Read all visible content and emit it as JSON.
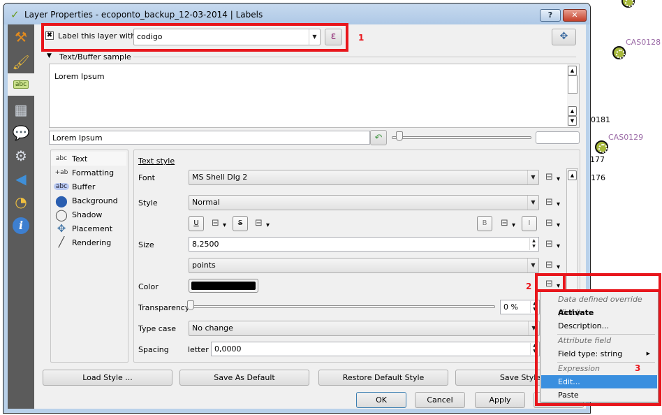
{
  "map": {
    "labels": [
      {
        "text": "CAS0128",
        "color": "purple"
      },
      {
        "text": "0181",
        "color": "black"
      },
      {
        "text": "CAS0129",
        "color": "purple"
      },
      {
        "text": "177",
        "color": "black"
      },
      {
        "text": "176",
        "color": "black"
      }
    ]
  },
  "window": {
    "title": "Layer Properties - ecoponto_backup_12-03-2014 | Labels",
    "help_label": "?",
    "close_label": "✕"
  },
  "sidebar": {
    "items": [
      {
        "name": "general",
        "icon": "tools-icon",
        "glyph": "⚒"
      },
      {
        "name": "style",
        "icon": "style-brush-icon",
        "glyph": "🖌"
      },
      {
        "name": "labels",
        "icon": "labels-abc-icon",
        "glyph": "abc",
        "active": true
      },
      {
        "name": "fields",
        "icon": "table-icon",
        "glyph": "▦"
      },
      {
        "name": "display",
        "icon": "speech-bubble-icon",
        "glyph": "💬"
      },
      {
        "name": "actions",
        "icon": "gear-run-icon",
        "glyph": "⚙"
      },
      {
        "name": "joins",
        "icon": "join-arrow-icon",
        "glyph": "◀"
      },
      {
        "name": "diagrams",
        "icon": "diagram-icon",
        "glyph": "◔"
      },
      {
        "name": "metadata",
        "icon": "info-icon",
        "glyph": "i"
      }
    ]
  },
  "label_header": {
    "checkbox_checked": true,
    "checkbox_label": "Label this layer with",
    "field_value": "codigo",
    "expression_button": "ε",
    "annotation_1": "1"
  },
  "sample": {
    "section_title": "Text/Buffer sample",
    "preview_text": "Lorem Ipsum",
    "input_value": "Lorem Ipsum",
    "scale_value": ""
  },
  "categories": [
    {
      "icon": "abc",
      "label": "Text",
      "selected": true
    },
    {
      "icon": "+ab",
      "label": "Formatting"
    },
    {
      "icon": "abc",
      "label": "Buffer"
    },
    {
      "icon": "⬤",
      "label": "Background"
    },
    {
      "icon": "◯",
      "label": "Shadow"
    },
    {
      "icon": "✥",
      "label": "Placement"
    },
    {
      "icon": "╱",
      "label": "Rendering"
    }
  ],
  "text_style": {
    "title": "Text style",
    "font_label": "Font",
    "font_value": "MS Shell Dlg 2",
    "style_label": "Style",
    "style_value": "Normal",
    "underline": "U",
    "strikeout": "S",
    "bold": "B",
    "italic": "I",
    "size_label": "Size",
    "size_value": "8,2500",
    "unit_value": "points",
    "color_label": "Color",
    "color_value": "#000000",
    "annotation_2": "2",
    "transparency_label": "Transparency",
    "transparency_percent": 0,
    "transparency_value": "0 %",
    "typecase_label": "Type case",
    "typecase_value": "No change",
    "spacing_label": "Spacing",
    "spacing_sub": "letter",
    "spacing_value": "0,0000"
  },
  "style_buttons": {
    "load": "Load Style ...",
    "save_default": "Save As Default",
    "restore_default": "Restore Default Style",
    "save": "Save Style"
  },
  "dialog_buttons": {
    "ok": "OK",
    "cancel": "Cancel",
    "apply": "Apply"
  },
  "context_menu": {
    "header_override": "Data defined override (field)",
    "activate": "Activate",
    "description": "Description...",
    "header_attribute": "Attribute field",
    "field_type": "Field type: string",
    "header_expression": "Expression",
    "annotation_3": "3",
    "edit": "Edit...",
    "paste": "Paste"
  }
}
